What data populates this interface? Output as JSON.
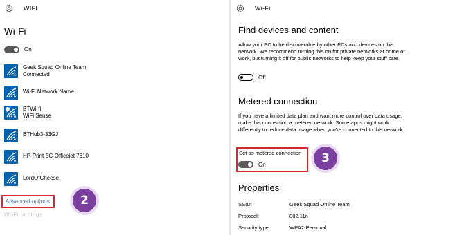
{
  "left": {
    "window_title": "WIFI",
    "heading": "Wi-Fi",
    "wifi_toggle": "On",
    "networks": [
      {
        "name": "Geek Squad Online Team",
        "status": "Connected",
        "secured": false
      },
      {
        "name": "Wi-Fi Network Name",
        "status": "",
        "secured": false
      },
      {
        "name": "BTWi-fi",
        "status": "WiFi Sense",
        "secured": true
      },
      {
        "name": "BTHub3-33GJ",
        "status": "",
        "secured": false
      },
      {
        "name": "HP-Print-5C-Officejet 7610",
        "status": "",
        "secured": false
      },
      {
        "name": "LordOfCheese",
        "status": "",
        "secured": false
      }
    ],
    "advanced_options": "Advanced options",
    "cutoff_link": "Wi-Fi settings",
    "step_badge": "2"
  },
  "right": {
    "window_title": "Wi-Fi",
    "find_devices": {
      "heading": "Find devices and content",
      "description": "Allow your PC to be discoverable by other PCs and devices on this network. We recommend turning this on for private networks at home or work, but turning it off for public networks to help keep your stuff safe.",
      "toggle": "Off"
    },
    "metered": {
      "heading": "Metered connection",
      "description": "If you have a limited data plan and want more control over data usage, make this connection a metered network. Some apps might work differently to reduce data usage when you're connected to this network.",
      "setting_label": "Set as metered connection",
      "toggle": "On"
    },
    "step_badge": "3",
    "properties": {
      "heading": "Properties",
      "rows": [
        {
          "label": "SSID:",
          "value": "Geek Squad Online Team"
        },
        {
          "label": "Protocol:",
          "value": "802.11n"
        },
        {
          "label": "Security type:",
          "value": "WPA2-Personal"
        }
      ]
    }
  },
  "colors": {
    "accent": "#0063b1",
    "highlight_border": "#d8262f",
    "badge": "#7b3fa0",
    "link": "#5a7fa8"
  },
  "icons": [
    "gear-icon",
    "wifi-icon",
    "shield-icon"
  ]
}
